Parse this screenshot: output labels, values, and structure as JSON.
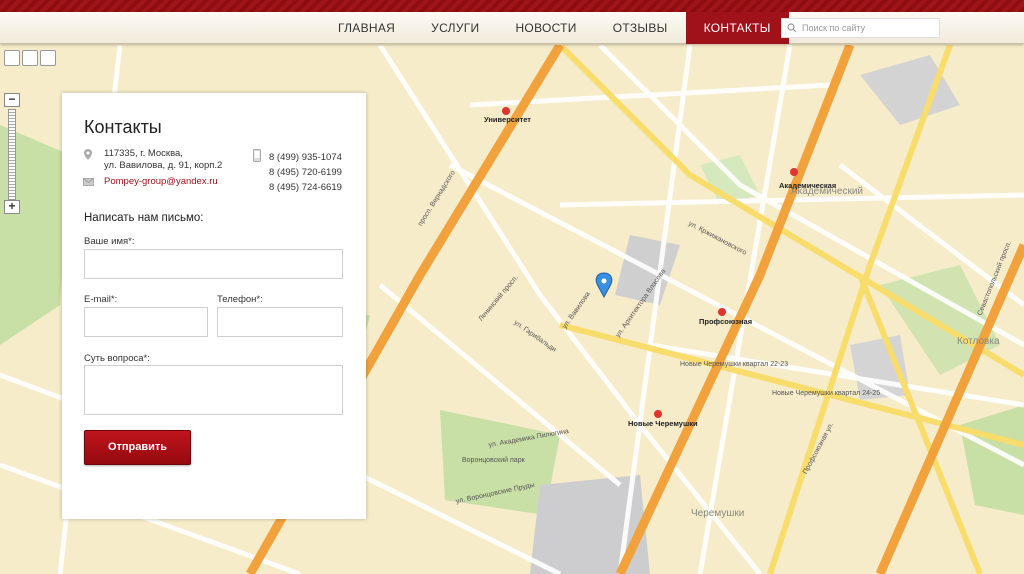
{
  "nav": {
    "items": [
      "ГЛАВНАЯ",
      "УСЛУГИ",
      "НОВОСТИ",
      "ОТЗЫВЫ",
      "КОНТАКТЫ"
    ],
    "active": "КОНТАКТЫ",
    "search_placeholder": "Поиск по сайту"
  },
  "contacts": {
    "title": "Контакты",
    "address_line1": "117335, г. Москва,",
    "address_line2": "ул. Вавилова, д. 91, корп.2",
    "email": "Pompey-group@yandex.ru",
    "phones": [
      "8 (499) 935-1074",
      "8 (495) 720-6199",
      "8 (495) 724-6619"
    ]
  },
  "form": {
    "title": "Написать нам письмо:",
    "name_label": "Ваше имя*:",
    "email_label": "E-mail*:",
    "phone_label": "Телефон*:",
    "subject_label": "Суть вопроса*:",
    "submit_label": "Отправить"
  },
  "map": {
    "districts": [
      "Академический",
      "Котловка",
      "Черемушки"
    ],
    "metro": [
      "Университет",
      "Академическая",
      "Профсоюзная",
      "Новые Черемушки"
    ],
    "streets": [
      "просп. Вернадского",
      "Ленинский просп.",
      "ул. Вавилова",
      "Севастопольский просп.",
      "ул. Кржижановского",
      "ул. Гарибальди",
      "ул. Архитектора Власова",
      "Новые Черемушки квартал 22-23",
      "Новые Черемушки квартал 24-25",
      "Воронцовский парк",
      "ул. Воронцовские Пруды",
      "ул. Академика Пилюгина",
      "Профсоюзная ул."
    ]
  },
  "colors": {
    "accent": "#a0121a",
    "map_bg": "#f6ecc9",
    "road": "#f2a23c",
    "park": "#c8dfa6"
  }
}
